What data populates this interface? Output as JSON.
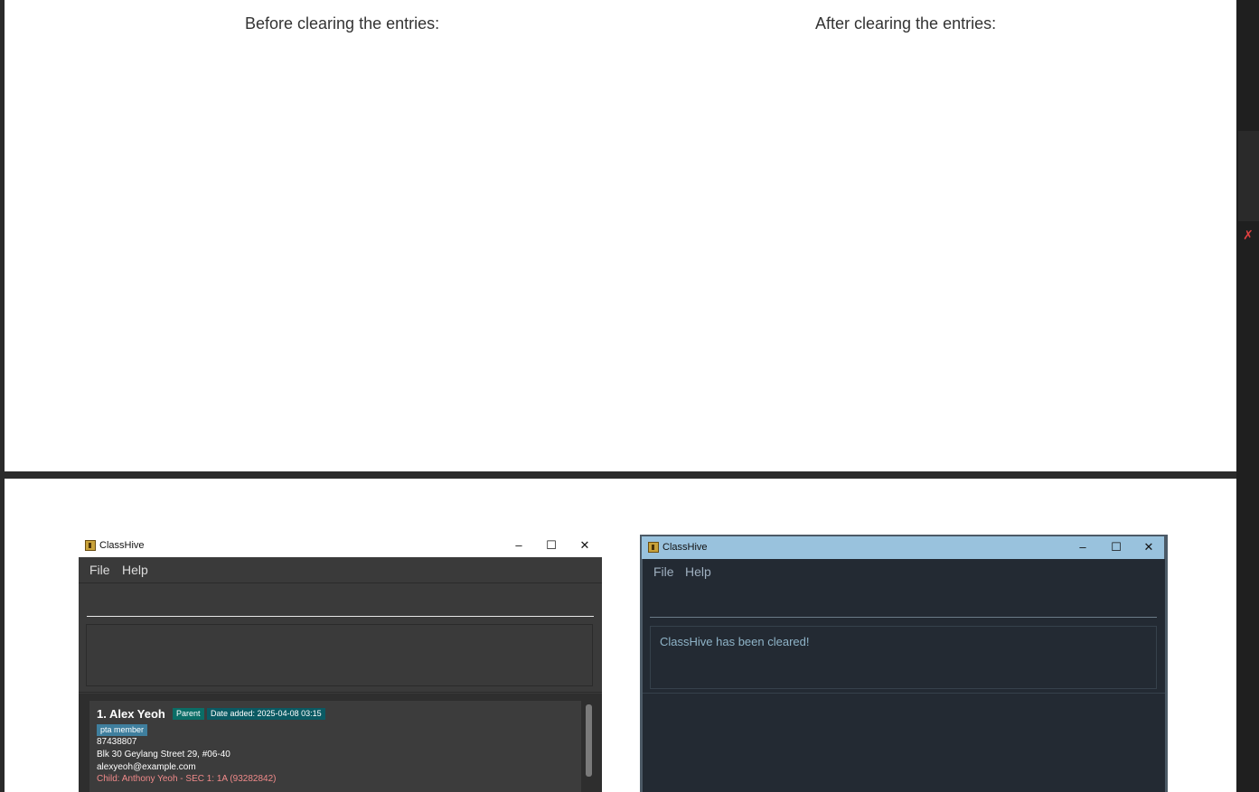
{
  "document": {
    "caption_before": "Before clearing the entries:",
    "caption_after": "After clearing the entries:"
  },
  "left_window": {
    "title": "ClassHive",
    "controls": {
      "minimize": "–",
      "maximize": "☐",
      "close": "✕"
    },
    "menu": {
      "file": "File",
      "help": "Help"
    },
    "command_input_value": "",
    "result_text": "",
    "persons": [
      {
        "name": "1. Alex Yeoh",
        "role_tag": "Parent",
        "date_tag": "Date added: 2025-04-08 03:15",
        "tag": "pta member",
        "phone": "87438807",
        "address": "Blk 30 Geylang Street 29, #06-40",
        "email": "alexyeoh@example.com",
        "child": "Child: Anthony Yeoh - SEC 1: 1A (93282842)"
      }
    ]
  },
  "right_window": {
    "title": "ClassHive",
    "controls": {
      "minimize": "–",
      "maximize": "☐",
      "close": "✕"
    },
    "menu": {
      "file": "File",
      "help": "Help"
    },
    "command_input_value": "",
    "result_text": "ClassHive has been cleared!"
  },
  "colors": {
    "left_theme_bg": "#3a3a3a",
    "right_theme_bg": "#232a33",
    "right_titlebar": "#99c2dd",
    "role_tag": "#0b6d66",
    "pta_tag": "#3f7f9e",
    "child_text": "#f08a8a"
  },
  "icons": {
    "app_icon": "app-logo-icon",
    "side_mic": "mic-muted-icon"
  }
}
